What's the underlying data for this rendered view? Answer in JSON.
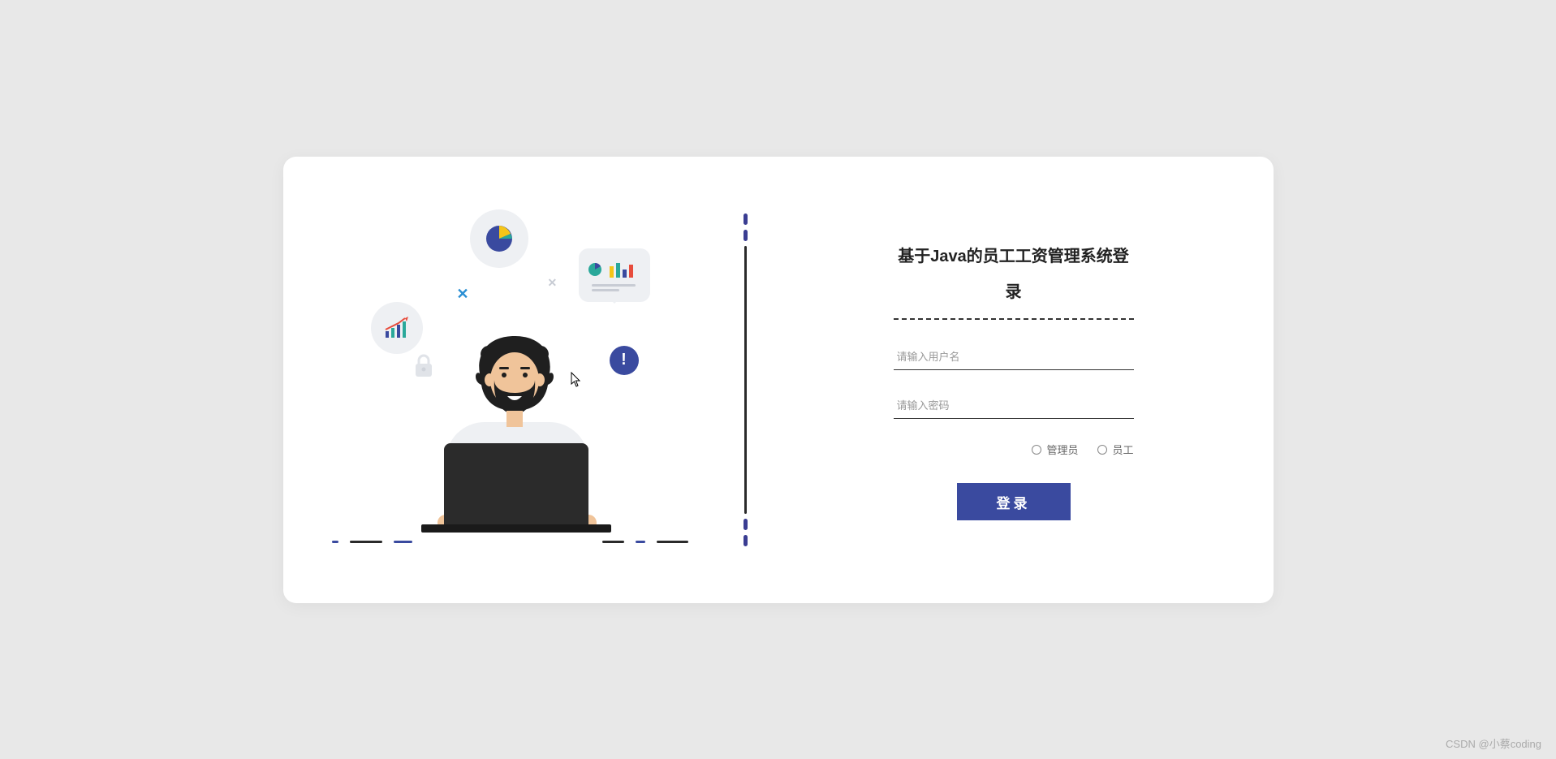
{
  "form": {
    "title": "基于Java的员工工资管理系统登录",
    "username_placeholder": "请输入用户名",
    "password_placeholder": "请输入密码",
    "username_value": "",
    "password_value": "",
    "role_options": {
      "admin": "管理员",
      "employee": "员工"
    },
    "login_button": "登录"
  },
  "watermark": "CSDN @小蔡coding",
  "colors": {
    "accent": "#3a4a9f",
    "background": "#e8e8e8",
    "card": "#ffffff"
  }
}
